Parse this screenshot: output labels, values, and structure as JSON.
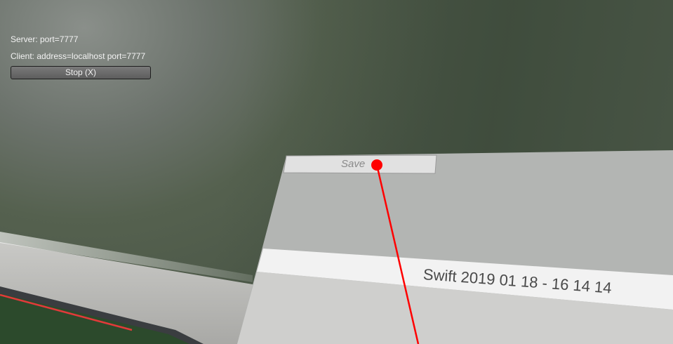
{
  "hud": {
    "server_line": "Server: port=7777",
    "client_line": "Client: address=localhost port=7777",
    "stop_label": "Stop (X)"
  },
  "panel": {
    "save_label": "Save",
    "file_field_value": "Swift 2019 01 18 - 16 14 14"
  },
  "colors": {
    "pointer": "#ff0000",
    "panel": "#b3b5b3",
    "field": "#f2f2f2"
  }
}
